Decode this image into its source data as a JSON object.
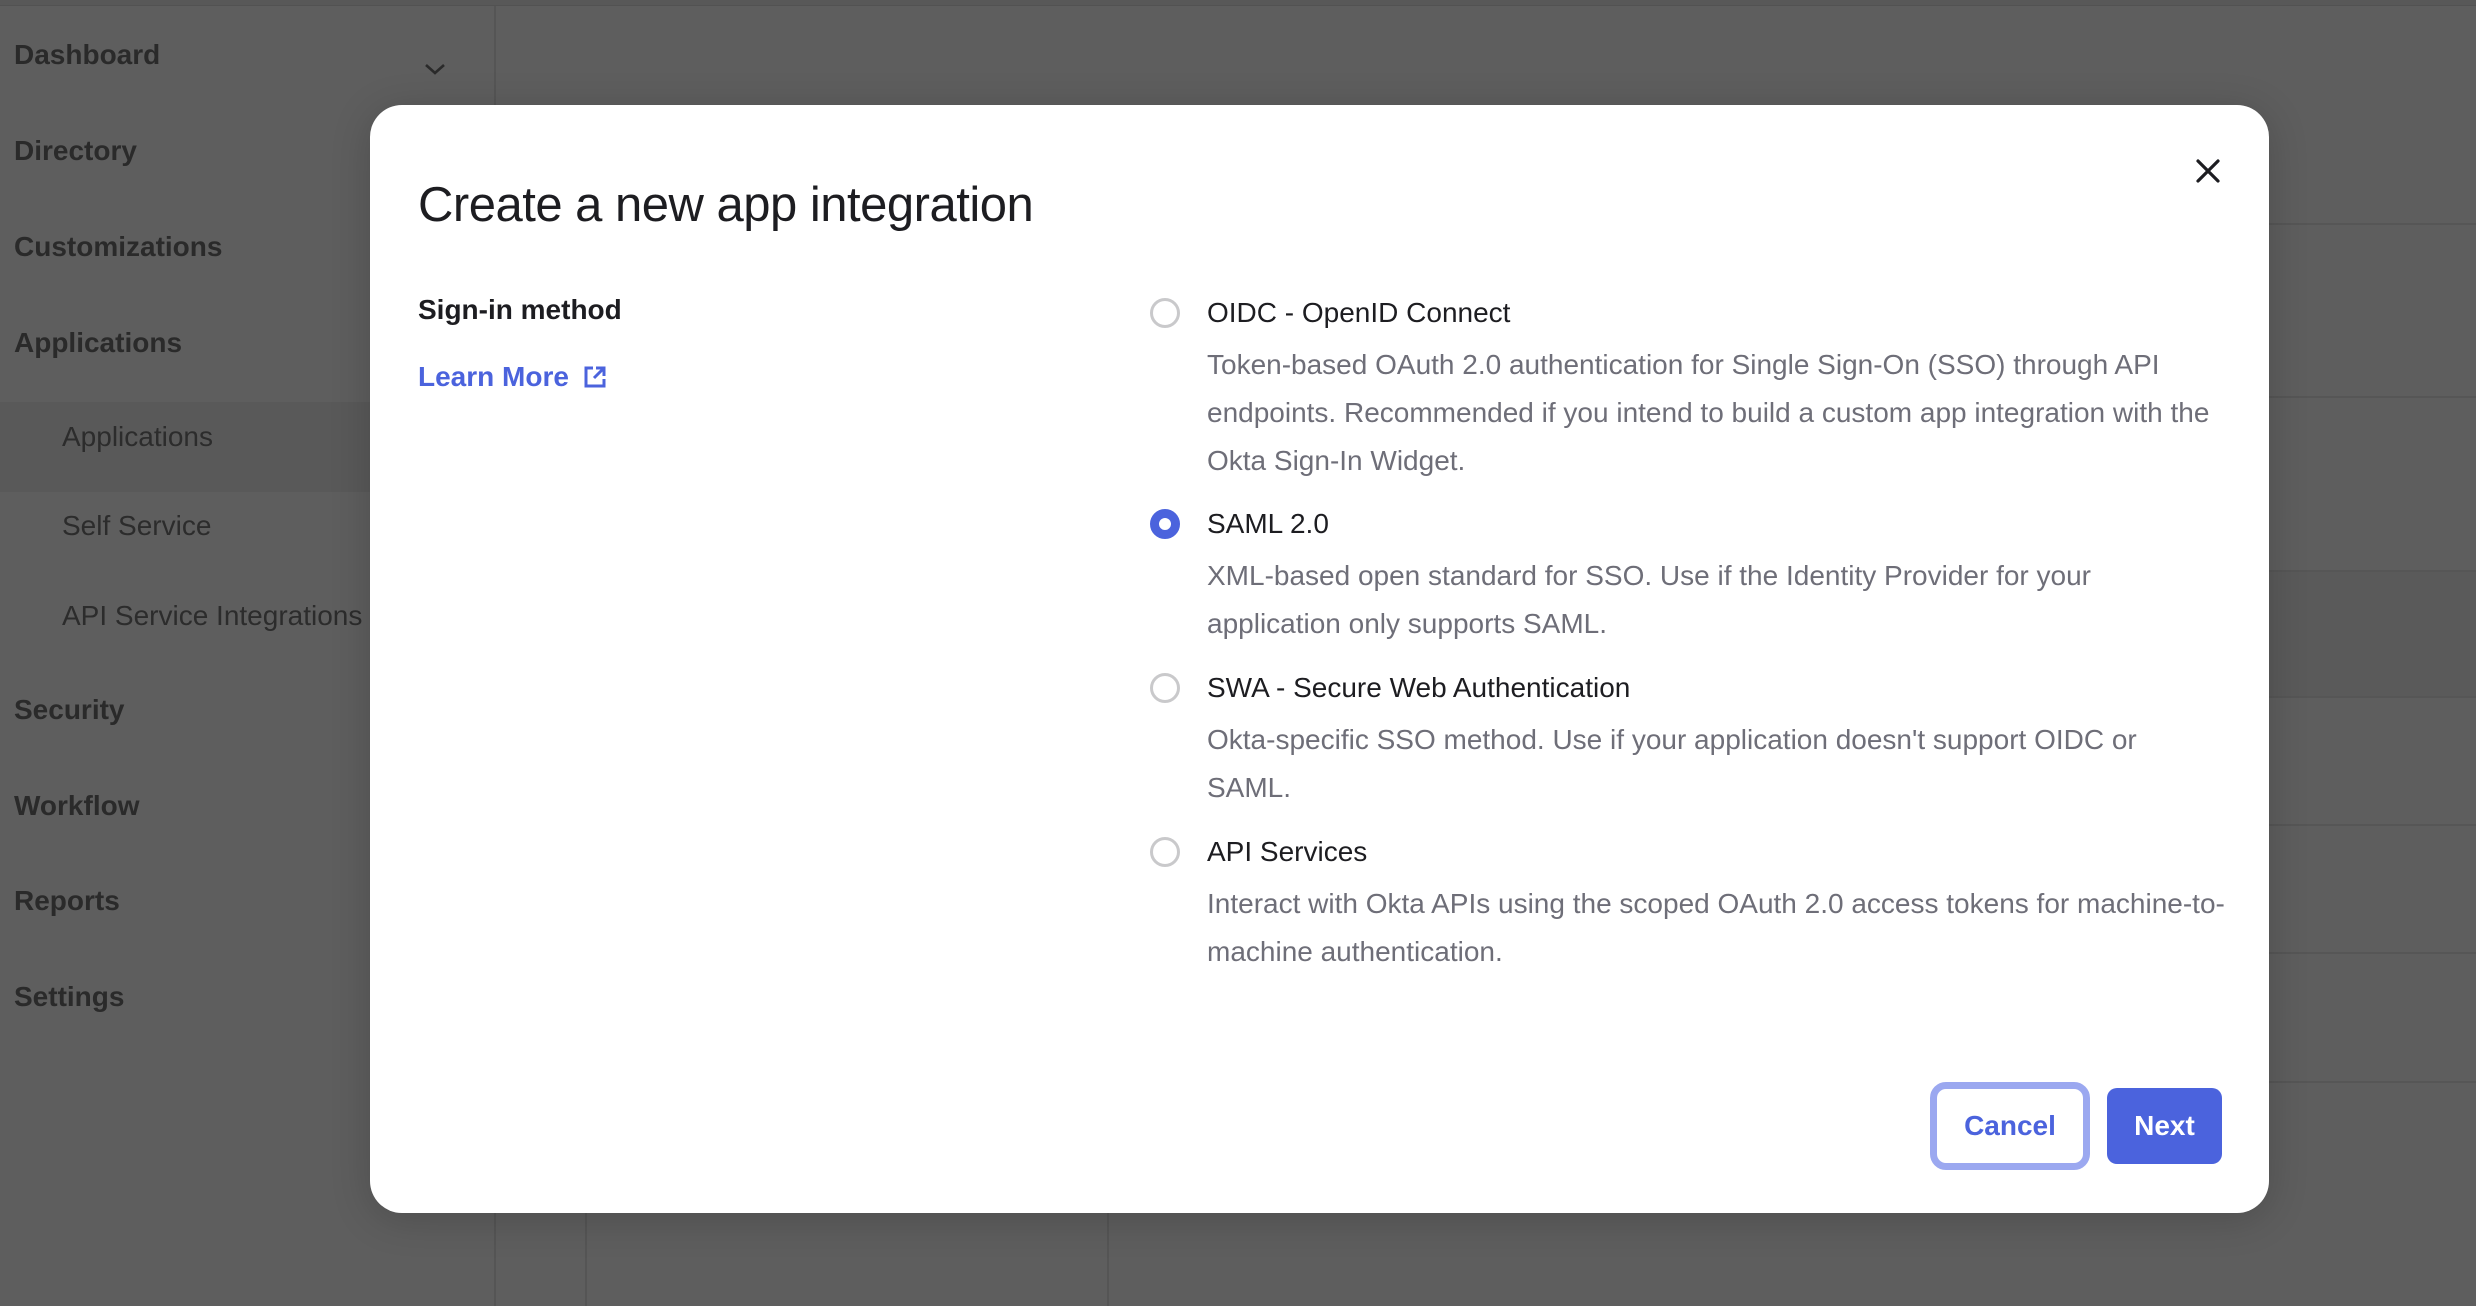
{
  "sidebar": {
    "items": [
      {
        "label": "Dashboard",
        "icon": "chevron-down-icon"
      },
      {
        "label": "Directory"
      },
      {
        "label": "Customizations"
      },
      {
        "label": "Applications"
      },
      {
        "label": "Security"
      },
      {
        "label": "Workflow"
      },
      {
        "label": "Reports"
      },
      {
        "label": "Settings"
      }
    ],
    "sub_items": [
      {
        "label": "Applications",
        "active": true
      },
      {
        "label": "Self Service"
      },
      {
        "label": "API Service Integrations"
      }
    ]
  },
  "modal": {
    "title": "Create a new app integration",
    "close_icon": "close-icon",
    "section_label": "Sign-in method",
    "learn_more": {
      "label": "Learn More",
      "icon": "external-link-icon"
    },
    "selected_option": "SAML 2.0",
    "options": [
      {
        "label": "OIDC - OpenID Connect",
        "description": "Token-based OAuth 2.0 authentication for Single Sign-On (SSO) through API endpoints. Recommended if you intend to build a custom app integration with the Okta Sign-In Widget.",
        "checked": false
      },
      {
        "label": "SAML 2.0",
        "description": "XML-based open standard for SSO. Use if the Identity Provider for your application only supports SAML.",
        "checked": true
      },
      {
        "label": "SWA - Secure Web Authentication",
        "description": "Okta-specific SSO method. Use if your application doesn't support OIDC or SAML.",
        "checked": false
      },
      {
        "label": "API Services",
        "description": "Interact with Okta APIs using the scoped OAuth 2.0 access tokens for machine-to-machine authentication.",
        "checked": false
      }
    ],
    "buttons": {
      "cancel": "Cancel",
      "next": "Next"
    }
  },
  "colors": {
    "accent": "#4b63dd",
    "focus_ring": "#9ba8f0",
    "overlay_bg": "#5e5e5e",
    "text_primary": "#1d1d21",
    "text_secondary": "#6e6e78"
  }
}
